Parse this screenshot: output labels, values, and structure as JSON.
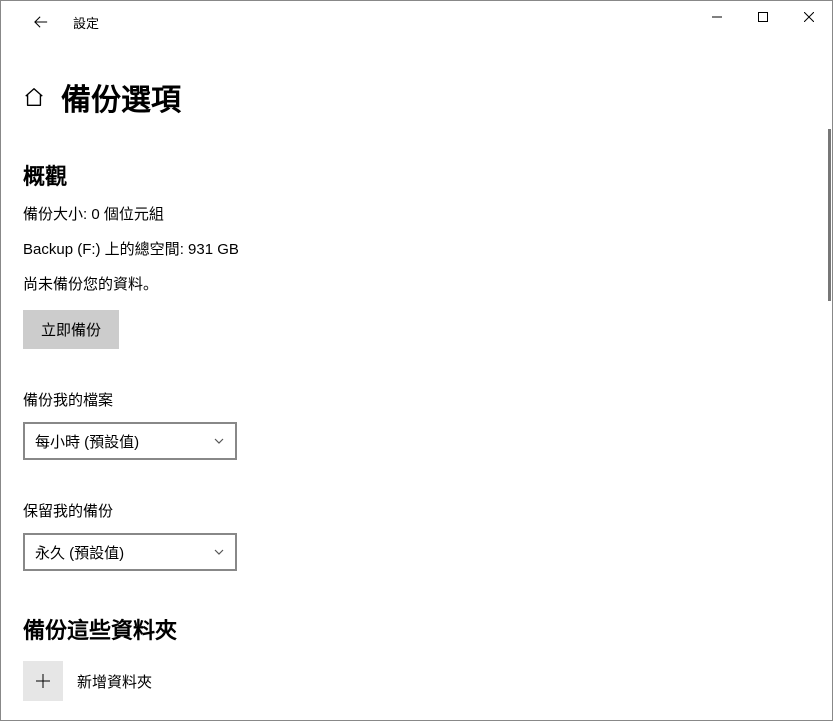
{
  "titlebar": {
    "title": "設定"
  },
  "page": {
    "title": "備份選項"
  },
  "overview": {
    "title": "概觀",
    "size_line": "備份大小: 0 個位元組",
    "space_line": "Backup (F:) 上的總空間: 931 GB",
    "status_line": "尚未備份您的資料。",
    "button": "立即備份"
  },
  "backup_files": {
    "label": "備份我的檔案",
    "selected": "每小時 (預設值)"
  },
  "keep_backups": {
    "label": "保留我的備份",
    "selected": "永久 (預設值)"
  },
  "folders": {
    "title": "備份這些資料夾",
    "add_label": "新增資料夾"
  }
}
